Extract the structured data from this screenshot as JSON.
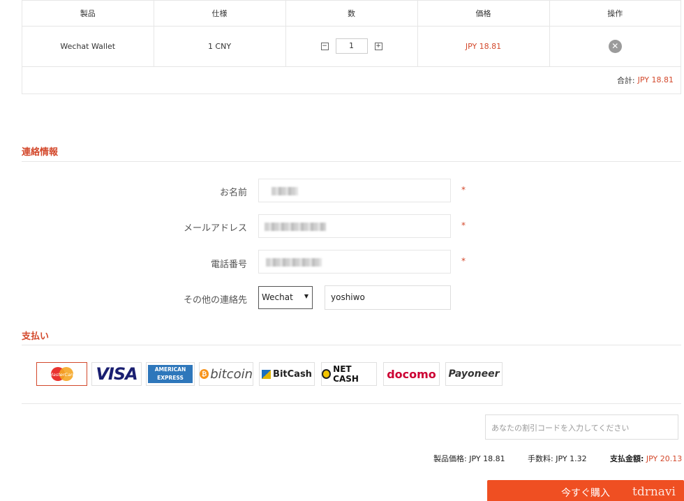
{
  "cart": {
    "headers": [
      "製品",
      "仕様",
      "数",
      "価格",
      "操作"
    ],
    "row": {
      "product": "Wechat Wallet",
      "spec": "1 CNY",
      "qty": "1",
      "price": "JPY 18.81",
      "minus": "−",
      "plus": "+",
      "remove_icon": "✕"
    },
    "total_label": "合計:",
    "total_value": "JPY 18.81"
  },
  "contact": {
    "title": "連絡情報",
    "name_label": "お名前",
    "email_label": "メールアドレス",
    "phone_label": "電話番号",
    "other_label": "その他の連絡先",
    "required_mark": "*",
    "other_select_value": "Wechat",
    "other_select_arrow": "▼",
    "other_value": "yoshiwo"
  },
  "payment": {
    "title": "支払い",
    "methods": [
      "MasterCard",
      "VISA",
      "AMERICAN EXPRESS",
      "bitcoin",
      "BitCash",
      "NET CASH",
      "docomo",
      "Payoneer"
    ]
  },
  "coupon": {
    "placeholder": "あなたの割引コードを入力してください"
  },
  "summary": {
    "product_label": "製品価格:",
    "product_value": "JPY 18.81",
    "fee_label": "手数料:",
    "fee_value": "JPY 1.32",
    "pay_label": "支払金額:",
    "pay_value": "JPY 20.13"
  },
  "buy_label": "今すぐ購入",
  "watermark": "tdrnavi",
  "colors": {
    "accent": "#d3482b",
    "buy_button": "#ef4f22"
  }
}
